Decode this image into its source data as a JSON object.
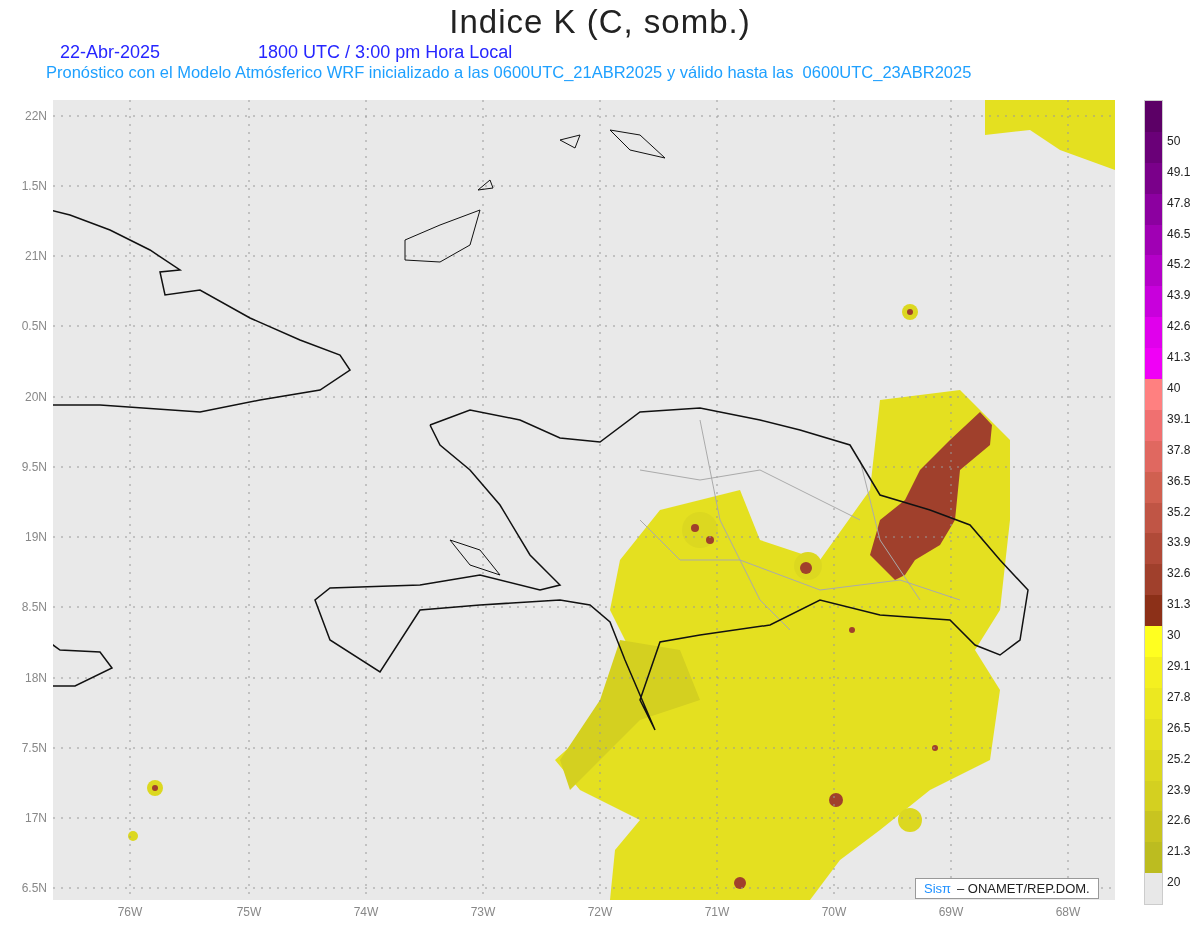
{
  "header": {
    "title": "Indice K (C, somb.)",
    "date": "22-Abr-2025",
    "time": "1800 UTC / 3:00 pm Hora Local",
    "description": "Pronóstico con el Modelo Atmósferico WRF inicializado a las 0600UTC_21ABR2025 y válido hasta las  0600UTC_23ABR2025"
  },
  "y_labels": [
    "22N",
    "1.5N",
    "21N",
    "0.5N",
    "20N",
    "9.5N",
    "19N",
    "8.5N",
    "18N",
    "7.5N",
    "17N",
    "6.5N"
  ],
  "x_labels": [
    "76W",
    "75W",
    "74W",
    "73W",
    "72W",
    "71W",
    "70W",
    "69W",
    "68W"
  ],
  "credit": {
    "logo": "Sisπ",
    "text": "– ONAMET/REP.DOM."
  },
  "colorbar": [
    {
      "color": "#5c0066"
    },
    {
      "color": "#6a0078",
      "label": "50"
    },
    {
      "color": "#7a008a",
      "label": "49.1"
    },
    {
      "color": "#8c00a0",
      "label": "47.8"
    },
    {
      "color": "#a000b4",
      "label": "46.5"
    },
    {
      "color": "#b400c8",
      "label": "45.2"
    },
    {
      "color": "#c800dc",
      "label": "43.9"
    },
    {
      "color": "#e000ec",
      "label": "42.6"
    },
    {
      "color": "#f000f6",
      "label": "41.3"
    },
    {
      "color": "#ff8080",
      "label": "40"
    },
    {
      "color": "#f07070",
      "label": "39.1"
    },
    {
      "color": "#e06860",
      "label": "37.8"
    },
    {
      "color": "#d06050",
      "label": "36.5"
    },
    {
      "color": "#c05545",
      "label": "35.2"
    },
    {
      "color": "#b04a38",
      "label": "33.9"
    },
    {
      "color": "#a0402c",
      "label": "32.6"
    },
    {
      "color": "#8c3018",
      "label": "31.3"
    },
    {
      "color": "#ffff20",
      "label": "30"
    },
    {
      "color": "#f4f020",
      "label": "29.1"
    },
    {
      "color": "#ece820",
      "label": "27.8"
    },
    {
      "color": "#e4e020",
      "label": "26.5"
    },
    {
      "color": "#dcd820",
      "label": "25.2"
    },
    {
      "color": "#d4d020",
      "label": "23.9"
    },
    {
      "color": "#c8c420",
      "label": "22.6"
    },
    {
      "color": "#bcbc20",
      "label": "21.3"
    },
    {
      "color": "#e8e8e8",
      "label": "20"
    }
  ]
}
